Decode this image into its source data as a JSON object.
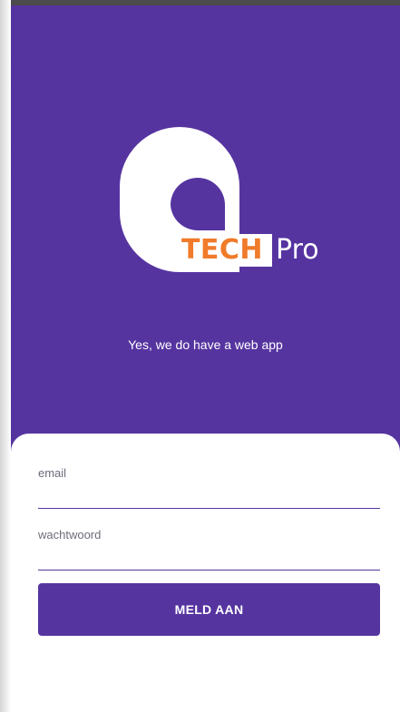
{
  "branding": {
    "logo_part1": "TECH",
    "logo_part2": "Pro",
    "tagline": "Yes, we do have a web app"
  },
  "login": {
    "email_label": "email",
    "password_label": "wachtwoord",
    "email_value": "",
    "password_value": "",
    "submit_label": "MELD AAN"
  },
  "colors": {
    "primary": "#5634a0",
    "accent": "#f07b2a",
    "background": "#ffffff"
  }
}
